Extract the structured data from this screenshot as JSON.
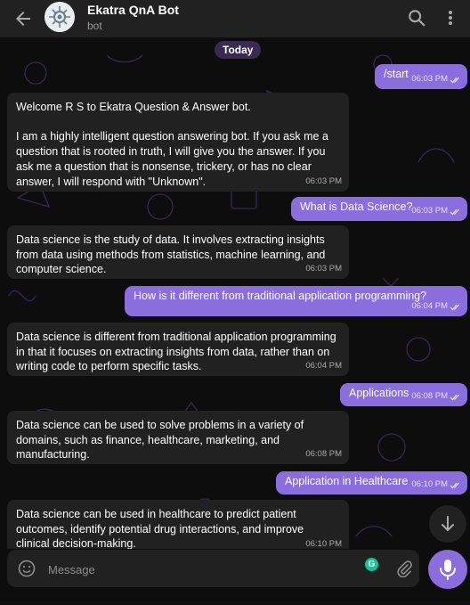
{
  "header": {
    "title": "Ekatra QnA Bot",
    "subtitle": "bot"
  },
  "date_divider": "Today",
  "messages": [
    {
      "direction": "out",
      "text": "/start",
      "time": "06:03 PM"
    },
    {
      "direction": "in",
      "text": "Welcome R S to Ekatra Question & Answer bot.\n\nI am a highly intelligent question answering bot. If you ask me a question that is rooted in truth, I will give you the answer. If you ask me a question that is nonsense, trickery, or has no clear answer, I will respond with \"Unknown\".",
      "time": "06:03 PM"
    },
    {
      "direction": "out",
      "text": "What is Data Science?",
      "time": "06:03 PM"
    },
    {
      "direction": "in",
      "text": "Data science is the study of data. It involves extracting insights from data using methods from statistics, machine learning, and computer science.",
      "time": "06:03 PM"
    },
    {
      "direction": "out",
      "text": "How is it different from traditional application programming?",
      "time": "06:04 PM"
    },
    {
      "direction": "in",
      "text": "Data science is different from traditional application programming in that it focuses on extracting insights from data, rather than on writing code to perform specific tasks.",
      "time": "06:04 PM"
    },
    {
      "direction": "out",
      "text": "Applications",
      "time": "06:08 PM"
    },
    {
      "direction": "in",
      "text": "Data science can be used to solve problems in a variety of domains, such as finance, healthcare, marketing, and manufacturing.",
      "time": "06:08 PM"
    },
    {
      "direction": "out",
      "text": "Application in Healthcare",
      "time": "06:10 PM"
    },
    {
      "direction": "in",
      "text": "Data science can be used in healthcare to predict patient outcomes, identify potential drug interactions, and improve clinical decision-making.",
      "time": "06:10 PM"
    }
  ],
  "composer": {
    "placeholder": "Message",
    "grammarly_letter": "G"
  },
  "colors": {
    "outgoing_bubble": "#8a6ede",
    "incoming_bubble": "#212121",
    "header_bg": "#212121",
    "accent": "#8a6ede"
  },
  "icons": [
    "back-arrow-icon",
    "bot-avatar-icon",
    "search-icon",
    "more-vert-icon",
    "double-check-icon",
    "arrow-down-icon",
    "emoji-icon",
    "grammarly-icon",
    "paperclip-icon",
    "microphone-icon"
  ]
}
